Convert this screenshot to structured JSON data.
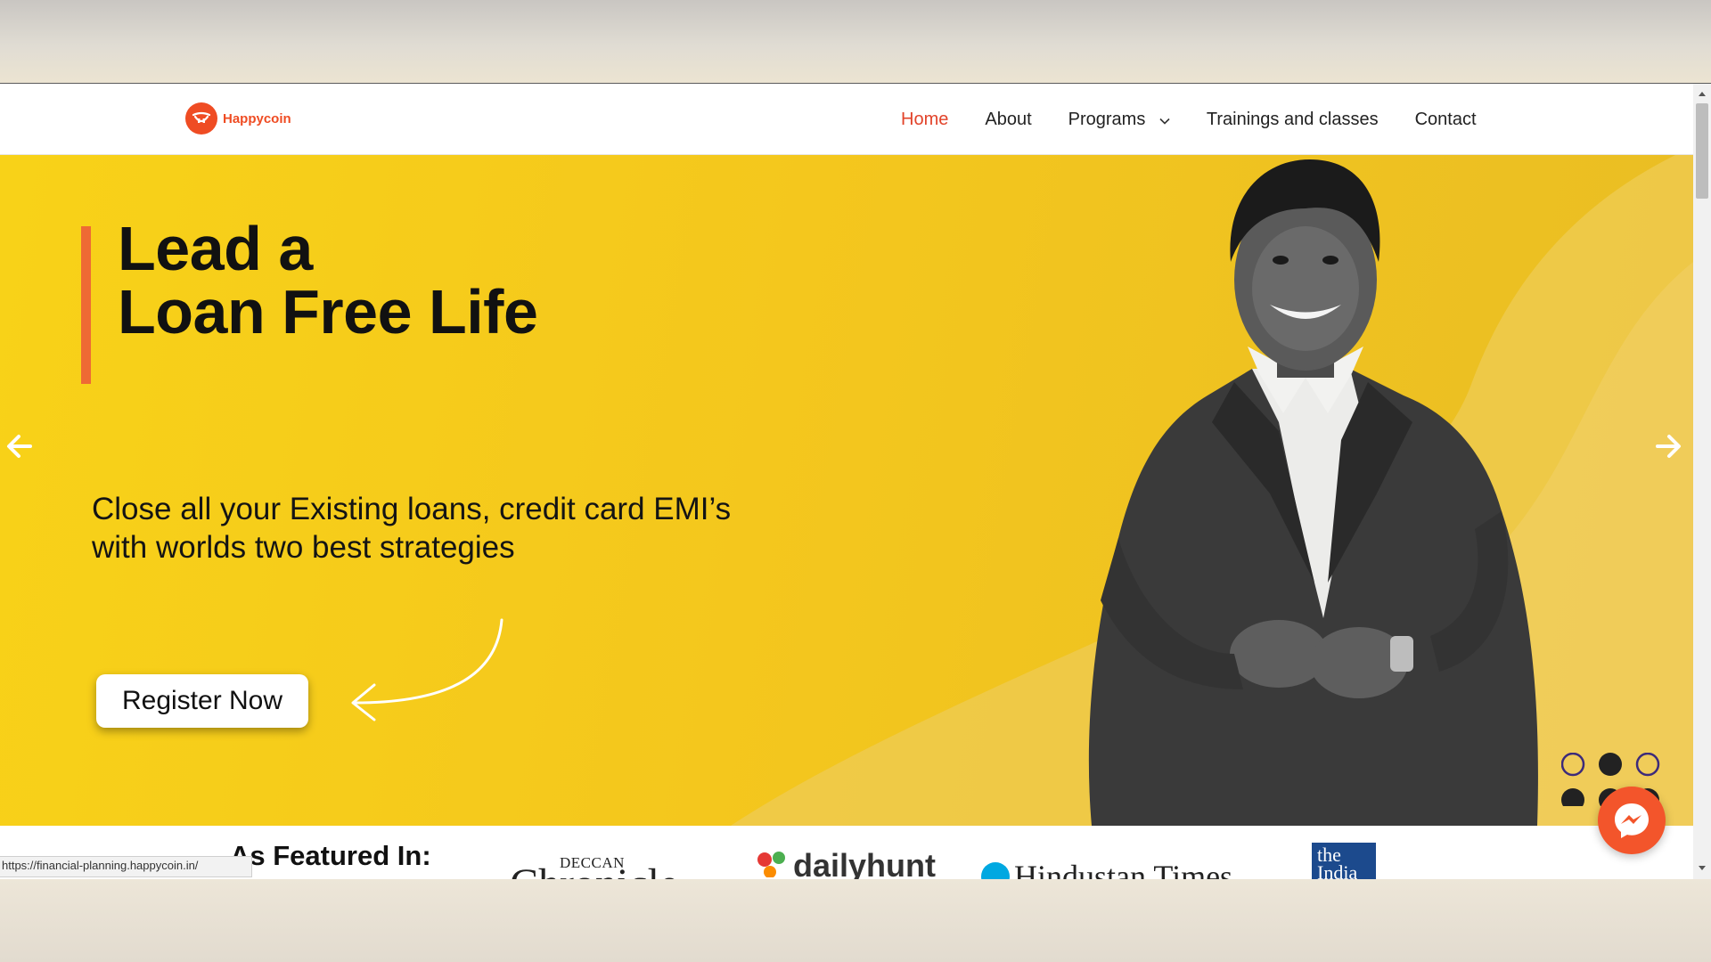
{
  "site": {
    "logo_text": "Happycoin"
  },
  "nav": {
    "items": [
      {
        "label": "Home",
        "active": true
      },
      {
        "label": "About"
      },
      {
        "label": "Programs",
        "has_dropdown": true
      },
      {
        "label": "Trainings and classes"
      },
      {
        "label": "Contact"
      }
    ]
  },
  "hero": {
    "title_line1": "Lead a",
    "title_line2": "Loan Free Life",
    "subtitle_line1": "Close all your Existing loans, credit card EMI’s",
    "subtitle_line2": "with worlds two best strategies",
    "cta_label": "Register Now",
    "prev_icon": "arrow-left-icon",
    "next_icon": "arrow-right-icon"
  },
  "featured": {
    "title": "As Featured In:",
    "logos": [
      {
        "name": "deccan-chronicle",
        "small": "DECCAN",
        "big": "Chronicle"
      },
      {
        "name": "dailyhunt",
        "text": "dailyhunt"
      },
      {
        "name": "hindustan-times",
        "text": "Hindustan Times"
      },
      {
        "name": "the-hindu",
        "line1": "the",
        "line2": "India"
      }
    ]
  },
  "status_bar": {
    "url": "https://financial-planning.happycoin.in/"
  },
  "colors": {
    "brand": "#ef4c23",
    "active_nav": "#e2432a",
    "hero_yellow": "#f8d218",
    "accent_bar": "#ee6a34"
  },
  "icons": {
    "messenger": "messenger-icon",
    "chevron": "chevron-down-icon"
  }
}
